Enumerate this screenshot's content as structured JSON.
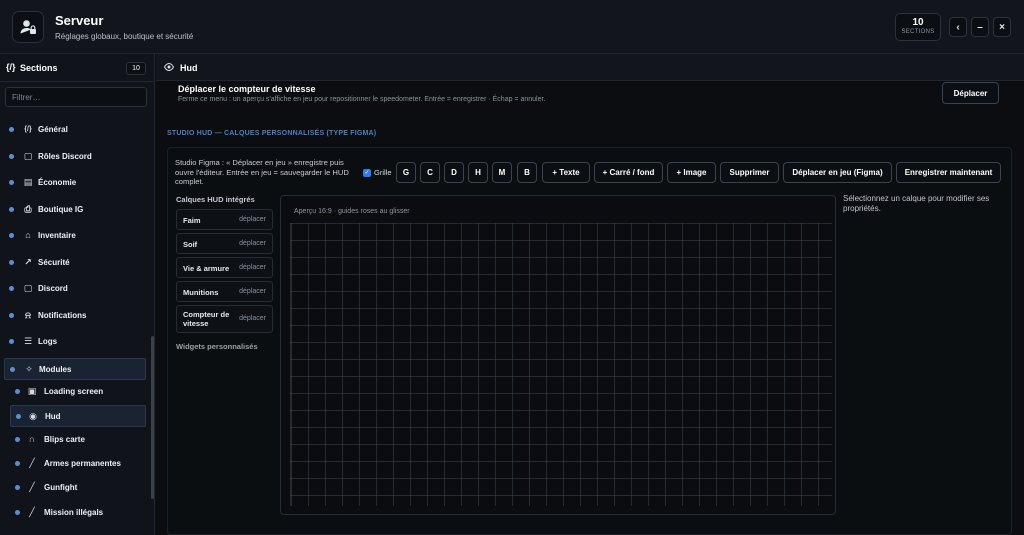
{
  "header": {
    "title": "Serveur",
    "subtitle": "Réglages globaux, boutique et sécurité",
    "sections_count": "10",
    "sections_label": "SECTIONS",
    "btn_back": "‹",
    "btn_min": "–",
    "btn_close": "×"
  },
  "sidebar": {
    "title": "Sections",
    "count": "10",
    "filter_placeholder": "Filtrer…",
    "items": [
      {
        "label": "Général",
        "icon": "code-braces-icon"
      },
      {
        "label": "Rôles Discord",
        "icon": "chat-bubble-icon"
      },
      {
        "label": "Économie",
        "icon": "calculator-icon"
      },
      {
        "label": "Boutique IG",
        "icon": "printer-icon"
      },
      {
        "label": "Inventaire",
        "icon": "backpack-icon"
      },
      {
        "label": "Sécurité",
        "icon": "megaphone-icon"
      },
      {
        "label": "Discord",
        "icon": "chat-bubble-icon"
      },
      {
        "label": "Notifications",
        "icon": "bell-icon"
      },
      {
        "label": "Logs",
        "icon": "document-icon"
      },
      {
        "label": "Modules",
        "icon": "puzzle-icon"
      },
      {
        "label": "Loading screen",
        "icon": "image-icon"
      },
      {
        "label": "Hud",
        "icon": "eye-icon"
      },
      {
        "label": "Blips carte",
        "icon": "headset-icon"
      },
      {
        "label": "Armes permanentes",
        "icon": "knife-icon"
      },
      {
        "label": "Gunfight",
        "icon": "knife-icon"
      },
      {
        "label": "Mission illégals",
        "icon": "knife-icon"
      }
    ]
  },
  "main": {
    "title": "Hud",
    "move": {
      "title": "Déplacer le compteur de vitesse",
      "desc": "Ferme ce menu : un aperçu s'affiche en jeu pour repositionner le speedometer. Entrée = enregistrer · Échap = annuler.",
      "button": "Déplacer"
    },
    "studio_label": "STUDIO HUD — CALQUES PERSONNALISÉS (TYPE FIGMA)",
    "studio_text": "Studio Figma : « Déplacer en jeu » enregistre puis ouvre l'éditeur. Entrée en jeu = sauvegarder le HUD complet.",
    "grid_label": "Grille",
    "toolbar": {
      "g": "G",
      "c": "C",
      "d": "D",
      "h": "H",
      "m": "M",
      "b": "B",
      "text": "+ Texte",
      "rect": "+ Carré / fond",
      "image": "+ Image",
      "delete": "Supprimer",
      "move_figma": "Déplacer en jeu (Figma)",
      "save": "Enregistrer maintenant"
    },
    "layers_title": "Calques HUD intégrés",
    "layers": [
      {
        "name": "Faim",
        "action": "déplacer"
      },
      {
        "name": "Soif",
        "action": "déplacer"
      },
      {
        "name": "Vie & armure",
        "action": "déplacer"
      },
      {
        "name": "Munitions",
        "action": "déplacer"
      },
      {
        "name": "Compteur de vitesse",
        "action": "déplacer"
      }
    ],
    "widgets_title": "Widgets personnalisés",
    "canvas_caption": "Aperçu 16:9 · guides roses au glisser",
    "props_hint": "Sélectionnez un calque pour modifier ses propriétés."
  }
}
